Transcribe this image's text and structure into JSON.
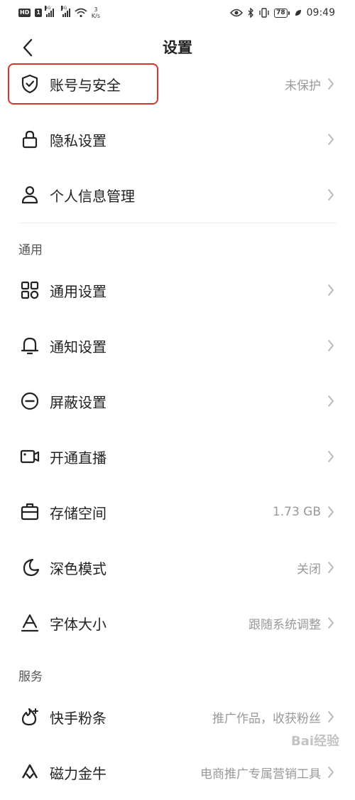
{
  "status_bar": {
    "hd": "HD",
    "sim": "1",
    "net_type_1": "4G",
    "net_type_2": "4G",
    "net_speed_value": "3",
    "net_speed_unit": "K/s",
    "battery": "78",
    "time": "09:49"
  },
  "header": {
    "title": "设置"
  },
  "rows": [
    {
      "label": "账号与安全",
      "value": "未保护",
      "icon": "shield-check-icon"
    },
    {
      "label": "隐私设置",
      "value": "",
      "icon": "lock-icon"
    },
    {
      "label": "个人信息管理",
      "value": "",
      "icon": "person-icon"
    },
    {
      "label": "通用设置",
      "value": "",
      "icon": "grid-icon"
    },
    {
      "label": "通知设置",
      "value": "",
      "icon": "bell-icon"
    },
    {
      "label": "屏蔽设置",
      "value": "",
      "icon": "block-icon"
    },
    {
      "label": "开通直播",
      "value": "",
      "icon": "video-camera-icon"
    },
    {
      "label": "存储空间",
      "value": "1.73 GB",
      "icon": "storage-icon"
    },
    {
      "label": "深色模式",
      "value": "关闭",
      "icon": "moon-icon"
    },
    {
      "label": "字体大小",
      "value": "跟随系统调整",
      "icon": "font-size-icon"
    },
    {
      "label": "快手粉条",
      "value": "推广作品，收获粉丝",
      "icon": "flame-icon"
    },
    {
      "label": "磁力金牛",
      "value": "电商推广专属营销工具",
      "icon": "magnet-icon"
    }
  ],
  "sections": {
    "general": "通用",
    "services": "服务"
  },
  "watermark": "Bai经验"
}
